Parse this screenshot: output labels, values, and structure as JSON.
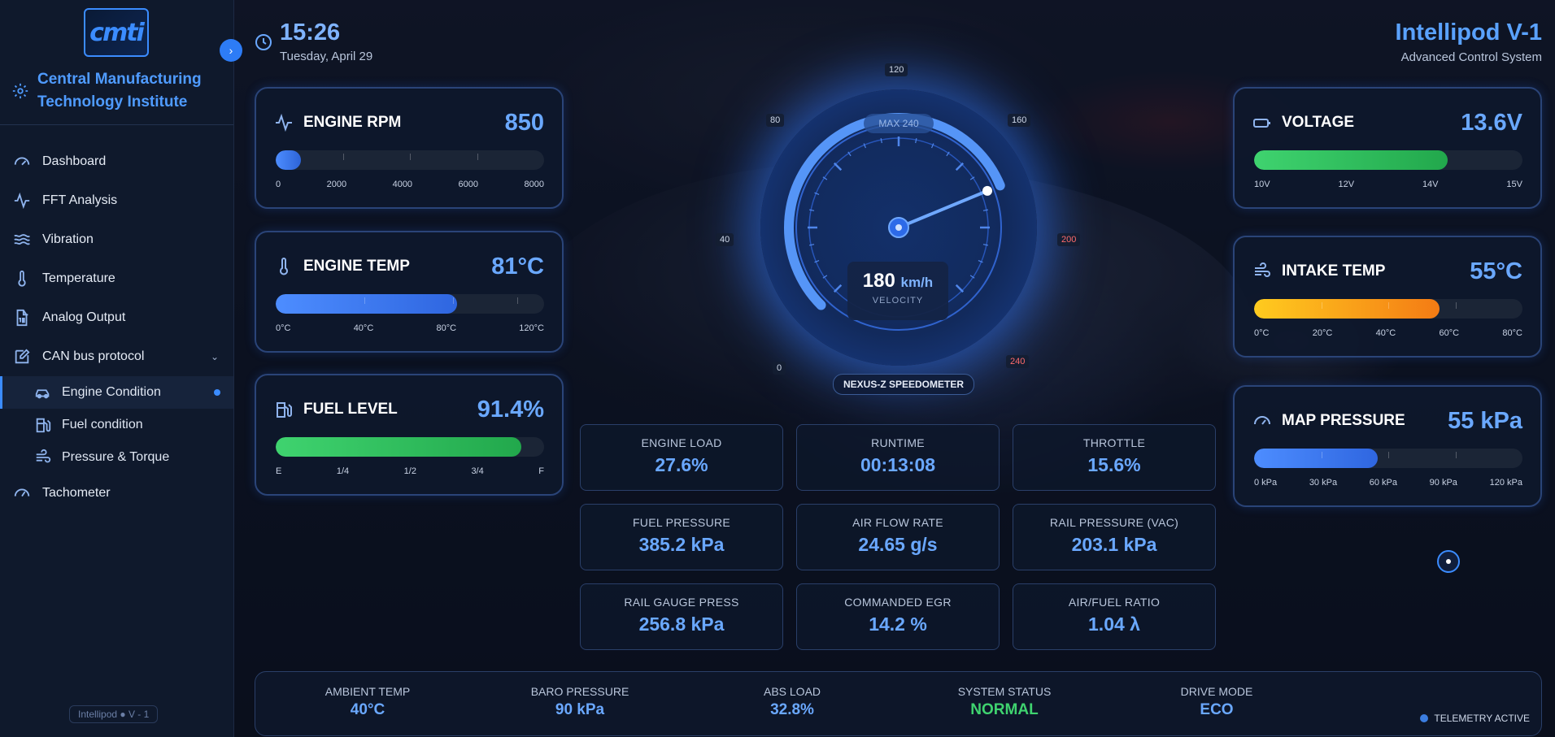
{
  "sidebar": {
    "logo_text": "cmti",
    "org_name": "Central Manufacturing Technology Institute",
    "items": [
      {
        "label": "Dashboard",
        "icon": "dashboard-gauge-icon"
      },
      {
        "label": "FFT Analysis",
        "icon": "activity-icon"
      },
      {
        "label": "Vibration",
        "icon": "waves-icon"
      },
      {
        "label": "Temperature",
        "icon": "thermometer-icon"
      },
      {
        "label": "Analog Output",
        "icon": "file-binary-icon"
      },
      {
        "label": "CAN bus protocol",
        "icon": "edit-square-icon"
      }
    ],
    "sub_items": [
      {
        "label": "Engine Condition",
        "icon": "car-icon",
        "active": true
      },
      {
        "label": "Fuel condition",
        "icon": "fuel-pump-icon"
      },
      {
        "label": "Pressure & Torque",
        "icon": "wind-icon"
      }
    ],
    "tachometer_label": "Tachometer",
    "version": "Intellipod",
    "version_suffix": "V - 1"
  },
  "header": {
    "time": "15:26",
    "date": "Tuesday, April 29",
    "title": "Intellipod V-1",
    "subtitle": "Advanced Control System"
  },
  "left_cards": [
    {
      "label": "ENGINE RPM",
      "value": "850",
      "fill": 0.095,
      "scale": [
        "0",
        "2000",
        "4000",
        "6000",
        "8000"
      ]
    },
    {
      "label": "ENGINE TEMP",
      "value": "81°C",
      "fill": 0.675,
      "scale": [
        "0°C",
        "40°C",
        "80°C",
        "120°C"
      ]
    },
    {
      "label": "FUEL LEVEL",
      "value": "91.4%",
      "fill": 0.914,
      "scale": [
        "E",
        "1/4",
        "1/2",
        "3/4",
        "F"
      ]
    }
  ],
  "right_cards": [
    {
      "label": "VOLTAGE",
      "value": "13.6V",
      "fill": 0.72,
      "scale": [
        "10V",
        "12V",
        "14V",
        "15V"
      ]
    },
    {
      "label": "INTAKE TEMP",
      "value": "55°C",
      "fill": 0.69,
      "scale": [
        "0°C",
        "20°C",
        "40°C",
        "60°C",
        "80°C"
      ]
    },
    {
      "label": "MAP PRESSURE",
      "value": "55 kPa",
      "fill": 0.46,
      "scale": [
        "0 kPa",
        "30 kPa",
        "60 kPa",
        "90 kPa",
        "120 kPa"
      ]
    }
  ],
  "speedometer": {
    "max_label": "MAX 240",
    "labels": [
      "0",
      "40",
      "80",
      "120",
      "160",
      "200",
      "240"
    ],
    "speed": "180",
    "unit": "km/h",
    "caption": "VELOCITY",
    "name": "NEXUS-Z SPEEDOMETER",
    "value": 180,
    "max": 240
  },
  "stats": [
    {
      "label": "ENGINE LOAD",
      "value": "27.6%"
    },
    {
      "label": "RUNTIME",
      "value": "00:13:08"
    },
    {
      "label": "THROTTLE",
      "value": "15.6%"
    },
    {
      "label": "FUEL PRESSURE",
      "value": "385.2 kPa"
    },
    {
      "label": "AIR FLOW RATE",
      "value": "24.65 g/s"
    },
    {
      "label": "RAIL PRESSURE (VAC)",
      "value": "203.1 kPa"
    },
    {
      "label": "RAIL GAUGE PRESS",
      "value": "256.8 kPa"
    },
    {
      "label": "COMMANDED EGR",
      "value": "14.2 %"
    },
    {
      "label": "AIR/FUEL RATIO",
      "value": "1.04 λ"
    }
  ],
  "bottom": [
    {
      "label": "AMBIENT TEMP",
      "value": "40°C"
    },
    {
      "label": "BARO PRESSURE",
      "value": "90 kPa"
    },
    {
      "label": "ABS LOAD",
      "value": "32.8%"
    },
    {
      "label": "SYSTEM STATUS",
      "value": "NORMAL"
    },
    {
      "label": "DRIVE MODE",
      "value": "ECO"
    }
  ],
  "telemetry": "TELEMETRY ACTIVE",
  "colors": {
    "accent": "#3b8cff",
    "value": "#6aa8ff",
    "ok": "#3fd36f"
  }
}
